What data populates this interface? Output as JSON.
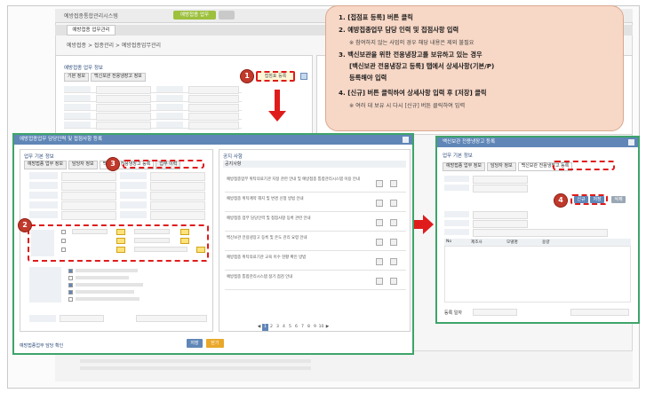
{
  "background": {
    "app_title": "예방접종통합관리시스템",
    "top_button": "예방접종 업무",
    "active_tab": "예방접종 업무관리",
    "breadcrumb": "예방접종 > 접종관리 > 예방접종업무관리",
    "section_title": "예방접종 업무 정보",
    "subtabs": [
      "기본 정보",
      "백신보관 전용냉장고 정보"
    ]
  },
  "callouts": {
    "step1_button": "접점표 등록",
    "numbers": [
      "1",
      "2",
      "3",
      "4"
    ]
  },
  "instructions": {
    "step1": "1. [접점표 등록] 버튼 클릭",
    "step2": "2. 예방접종업무 담당 인력 및 접점사항 입력",
    "step2_note": "※ 참여하지 않는 사업의 경우 해당 내용은 제외 불필요",
    "step3a": "3. 백신보관을 위한 전용냉장고를 보유하고 있는 경우",
    "step3b": "[백신보관 전용냉장고 등록] 탭에서 상세사항(기본/P)",
    "step3c": "등록해야 입력",
    "step4": "4. [신규] 버튼 클릭하여 상세사항 입력 후 [저장] 클릭",
    "step4_note": "※ 여러 대 보유 시 다시 [신규] 버튼 클릭하여 입력"
  },
  "dialog1": {
    "title": "예방접종업무 담당인력 및 접점사항 등록",
    "left_header": "업무 기본 정보",
    "tabs": [
      "예방접종 업무 정보",
      "담당자 정보",
      "백신보관 전용냉장고 등록",
      "업무 이력"
    ],
    "right_header": "공지 사항",
    "list_header": "공지사항",
    "list_items": [
      "예방접종업무 위탁의료기관 지정 관련 안내 및 예방접종 통합관리시스템 이용 안내",
      "예방접종 위탁계약 해지 및 변경 신청 방법 안내",
      "예방접종 업무 담당인력 및 접점사항 등록 관련 안내",
      "백신보관 전용냉장고 등록 및 온도 관리 요령 안내",
      "예방접종 위탁의료기관 교육 이수 현황 확인 방법",
      "예방접종 통합관리시스템 정기 점검 안내"
    ],
    "pager": [
      "◀",
      "1",
      "2",
      "3",
      "4",
      "5",
      "6",
      "7",
      "8",
      "9",
      "10",
      "▶"
    ],
    "footer_link": "예방접종업무 담당 확인",
    "btn_save": "저장",
    "btn_close": "닫기"
  },
  "dialog2": {
    "title": "백신보관 전용냉장고 등록",
    "header": "업무 기본 정보",
    "tabs": [
      "예방접종 업무 정보",
      "담당자 정보",
      "백신보관 전용냉장고 등록"
    ],
    "btn_new": "신규",
    "btn_save": "저장",
    "btn_delete": "삭제",
    "table_headers": [
      "No",
      "제조사",
      "모델명",
      "용량"
    ],
    "footer_label": "등록 일자"
  }
}
